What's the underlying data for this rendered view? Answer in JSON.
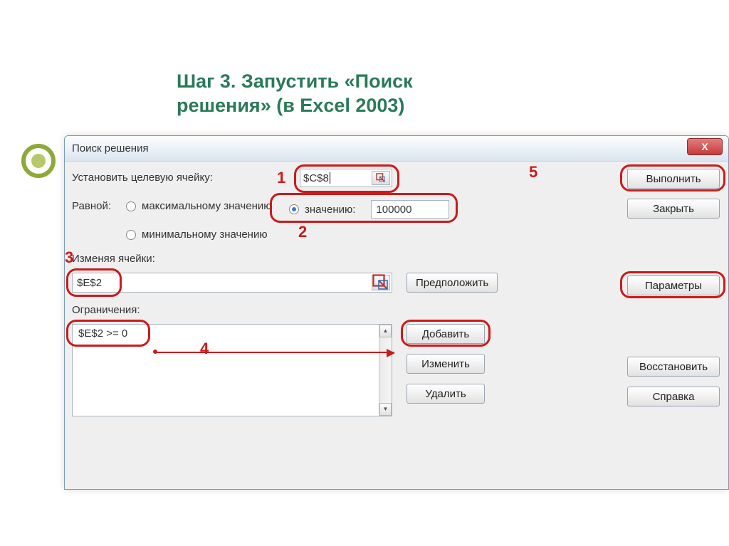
{
  "heading_line1": "Шаг 3. Запустить  «Поиск",
  "heading_line2": "решения» (в Excel 2003)",
  "dialog": {
    "title": "Поиск решения",
    "close_x": "X",
    "target": {
      "label": "Установить целевую ячейку:",
      "value": "$C$8"
    },
    "equal": {
      "label": "Равной:",
      "max": "максимальному значению",
      "min": "минимальному значению",
      "val": "значению:",
      "value_num": "100000"
    },
    "changing": {
      "label": "Изменяя ячейки:",
      "value": "$E$2",
      "guess": "Предположить"
    },
    "constraints": {
      "label": "Ограничения:",
      "item": "$E$2 >= 0",
      "add": "Добавить",
      "edit": "Изменить",
      "del": "Удалить"
    },
    "right": {
      "solve": "Выполнить",
      "close": "Закрыть",
      "options": "Параметры",
      "reset": "Восстановить",
      "help": "Справка"
    }
  },
  "annotations": {
    "n1": "1",
    "n2": "2",
    "n3": "3",
    "n4": "4",
    "n5": "5"
  }
}
